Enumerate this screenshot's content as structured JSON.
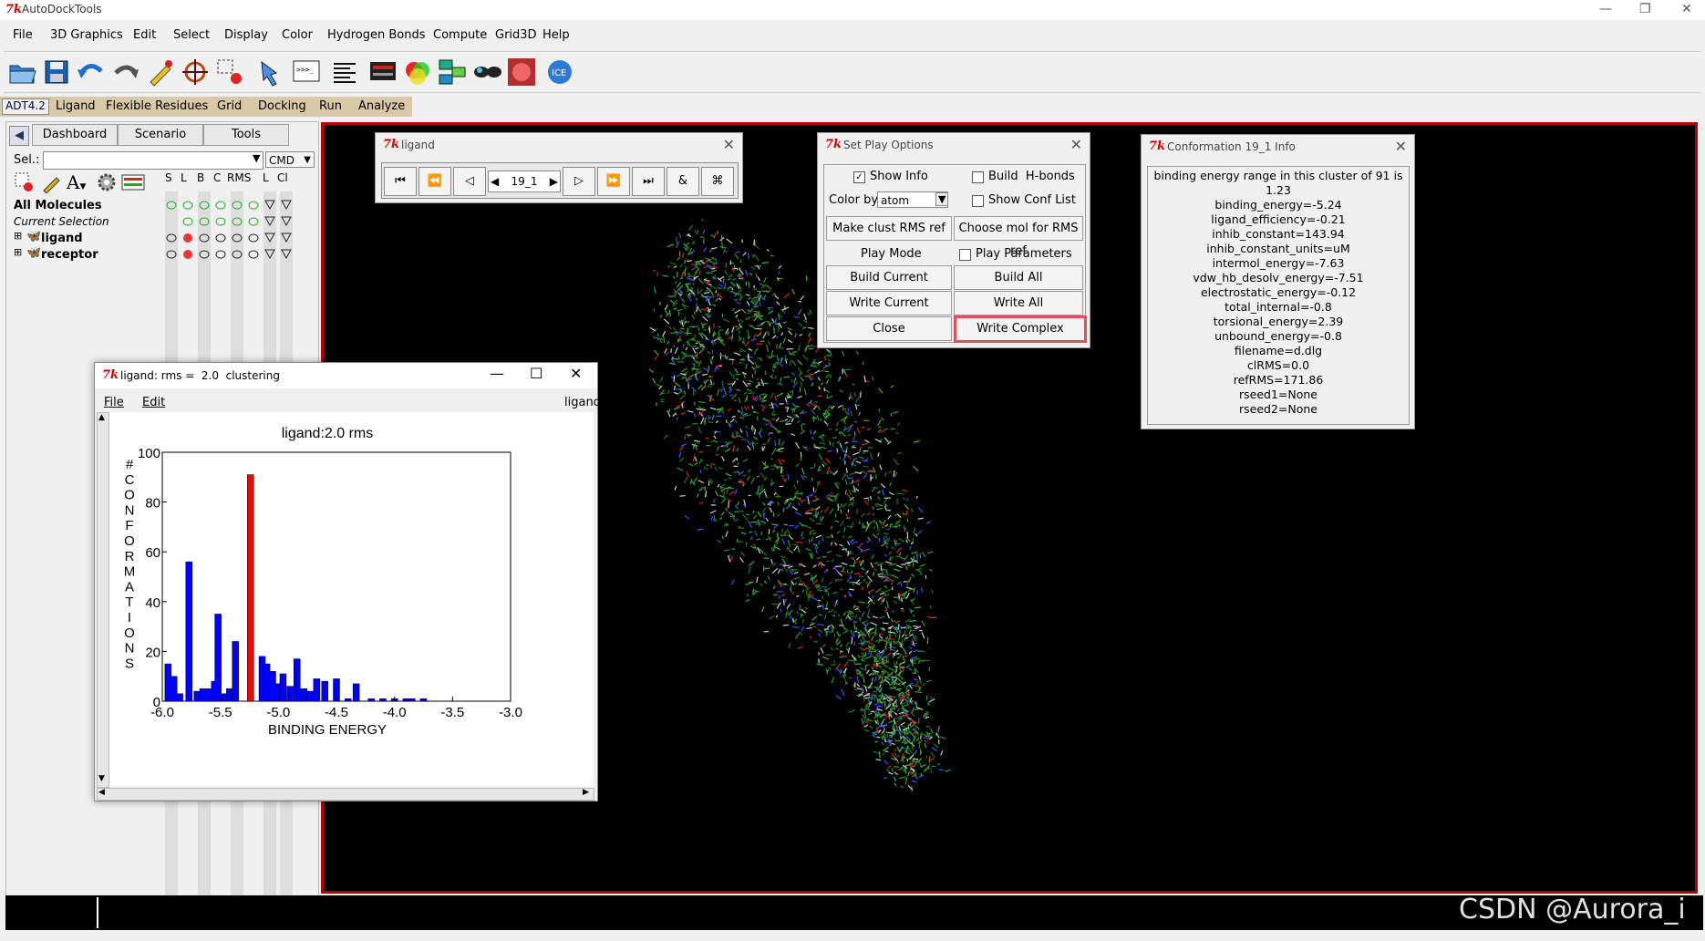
{
  "window": {
    "title": "AutoDockTools",
    "min": "—",
    "max": "❐",
    "close": "✕"
  },
  "menubar": [
    "File",
    "3D Graphics",
    "Edit",
    "Select",
    "Display",
    "Color",
    "Hydrogen Bonds",
    "Compute",
    "Grid3D",
    "Help"
  ],
  "adt": {
    "label": "ADT4.2",
    "items": [
      "Ligand",
      "Flexible Residues",
      "Grid",
      "Docking",
      "Run",
      "Analyze"
    ]
  },
  "leftpanel": {
    "tabs": [
      "Dashboard",
      "Scenario",
      "Tools"
    ],
    "sel_label": "Sel.:",
    "cmd": "CMD",
    "columns": [
      "S",
      "L",
      "B",
      "C",
      "RMS",
      "L",
      "Cl"
    ],
    "rows": {
      "all": "All Molecules",
      "current": "Current Selection",
      "ligand": "ligand",
      "receptor": "receptor"
    }
  },
  "ligand_player": {
    "title": "ligand",
    "frame": "19_1"
  },
  "play_options": {
    "title": "Set Play Options",
    "show_info": "Show Info",
    "build_hbonds": "Build  H-bonds",
    "color_by": "Color by",
    "color_value": "atom",
    "show_conf_list": "Show Conf List",
    "make_clust": "Make clust RMS ref",
    "choose_mol": "Choose mol for RMS ref",
    "play_mode": "Play Mode",
    "play_params": "Play Parameters",
    "build_current": "Build Current",
    "build_all": "Build All",
    "write_current": "Write Current",
    "write_all": "Write All",
    "close": "Close",
    "write_complex": "Write Complex"
  },
  "conf_info": {
    "title": "Conformation 19_1 Info",
    "lines": [
      "binding energy range in this cluster of 91 is 1.23",
      "binding_energy=-5.24",
      "ligand_efficiency=-0.21",
      "inhib_constant=143.94",
      "inhib_constant_units=uM",
      "intermol_energy=-7.63",
      "vdw_hb_desolv_energy=-7.51",
      "electrostatic_energy=-0.12",
      "total_internal=-0.8",
      "torsional_energy=2.39",
      "unbound_energy=-0.8",
      "filename=d.dlg",
      "clRMS=0.0",
      "refRMS=171.86",
      "rseed1=None",
      "rseed2=None"
    ]
  },
  "cluster_window": {
    "title": "ligand: rms =  2.0  clustering",
    "menu_file": "File",
    "menu_edit": "Edit",
    "menu_right": "ligand"
  },
  "chart_data": {
    "type": "bar",
    "title": "ligand:2.0 rms",
    "xlabel": "BINDING ENERGY",
    "ylabel": "# CONFORMATIONS",
    "xlim": [
      -6.0,
      -3.0
    ],
    "ylim": [
      0,
      100
    ],
    "xticks": [
      "-6.0",
      "-5.5",
      "-5.0",
      "-4.5",
      "-4.0",
      "-3.5",
      "-3.0"
    ],
    "yticks": [
      "0",
      "20",
      "40",
      "60",
      "80",
      "100"
    ],
    "highlight_color": "#ff0000",
    "bar_color": "#0000ff",
    "bars": [
      {
        "x": -5.95,
        "y": 15
      },
      {
        "x": -5.9,
        "y": 10
      },
      {
        "x": -5.85,
        "y": 3
      },
      {
        "x": -5.77,
        "y": 56
      },
      {
        "x": -5.7,
        "y": 4
      },
      {
        "x": -5.65,
        "y": 5
      },
      {
        "x": -5.6,
        "y": 5
      },
      {
        "x": -5.55,
        "y": 8
      },
      {
        "x": -5.52,
        "y": 35
      },
      {
        "x": -5.47,
        "y": 3
      },
      {
        "x": -5.42,
        "y": 5
      },
      {
        "x": -5.37,
        "y": 24
      },
      {
        "x": -5.24,
        "y": 91,
        "highlight": true
      },
      {
        "x": -5.14,
        "y": 18
      },
      {
        "x": -5.1,
        "y": 15
      },
      {
        "x": -5.05,
        "y": 12
      },
      {
        "x": -5.0,
        "y": 7
      },
      {
        "x": -4.96,
        "y": 11
      },
      {
        "x": -4.9,
        "y": 6
      },
      {
        "x": -4.84,
        "y": 17
      },
      {
        "x": -4.78,
        "y": 5
      },
      {
        "x": -4.73,
        "y": 4
      },
      {
        "x": -4.67,
        "y": 9
      },
      {
        "x": -4.6,
        "y": 8
      },
      {
        "x": -4.5,
        "y": 9
      },
      {
        "x": -4.4,
        "y": 1
      },
      {
        "x": -4.33,
        "y": 7
      },
      {
        "x": -4.2,
        "y": 1
      },
      {
        "x": -4.1,
        "y": 1
      },
      {
        "x": -4.0,
        "y": 1
      },
      {
        "x": -3.9,
        "y": 1
      },
      {
        "x": -3.85,
        "y": 1
      },
      {
        "x": -3.75,
        "y": 1
      }
    ]
  },
  "watermark": "CSDN @Aurora_i"
}
